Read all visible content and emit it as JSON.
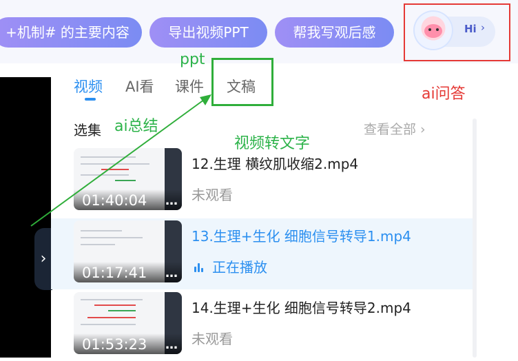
{
  "top_bar": {
    "prompt_pills": [
      "+机制# 的主要内容",
      "导出视频PPT",
      "帮我写观后感"
    ],
    "hi_label": "Hi",
    "hi_chevron": "›"
  },
  "tabs": [
    {
      "label": "视频",
      "active": true
    },
    {
      "label": "AI看",
      "active": false
    },
    {
      "label": "课件",
      "active": false
    },
    {
      "label": "文稿",
      "active": false
    }
  ],
  "annotations": {
    "ppt": "ppt",
    "ai_summary": "ai总结",
    "video_to_text": "视频转文字",
    "ai_qa": "ai问答"
  },
  "section": {
    "title": "选集",
    "view_all": "查看全部 ›"
  },
  "side_handle_icon": "›",
  "videos": [
    {
      "title": "12.生理 横纹肌收缩2.mp4",
      "duration": "01:40:04",
      "status": "未观看",
      "playing": false,
      "more": "…"
    },
    {
      "title": "13.生理+生化 细胞信号转导1.mp4",
      "duration": "01:17:41",
      "status": "正在播放",
      "playing": true,
      "more": "…"
    },
    {
      "title": "14.生理+生化 细胞信号转导2.mp4",
      "duration": "01:53:23",
      "status": "未观看",
      "playing": false,
      "more": "…"
    }
  ],
  "colors": {
    "accent_blue": "#2b8ff0",
    "pill_gradient_start": "#9f8ff5",
    "pill_gradient_end": "#7b8cf3",
    "annotation_green": "#2db34a",
    "annotation_red": "#e53935"
  }
}
